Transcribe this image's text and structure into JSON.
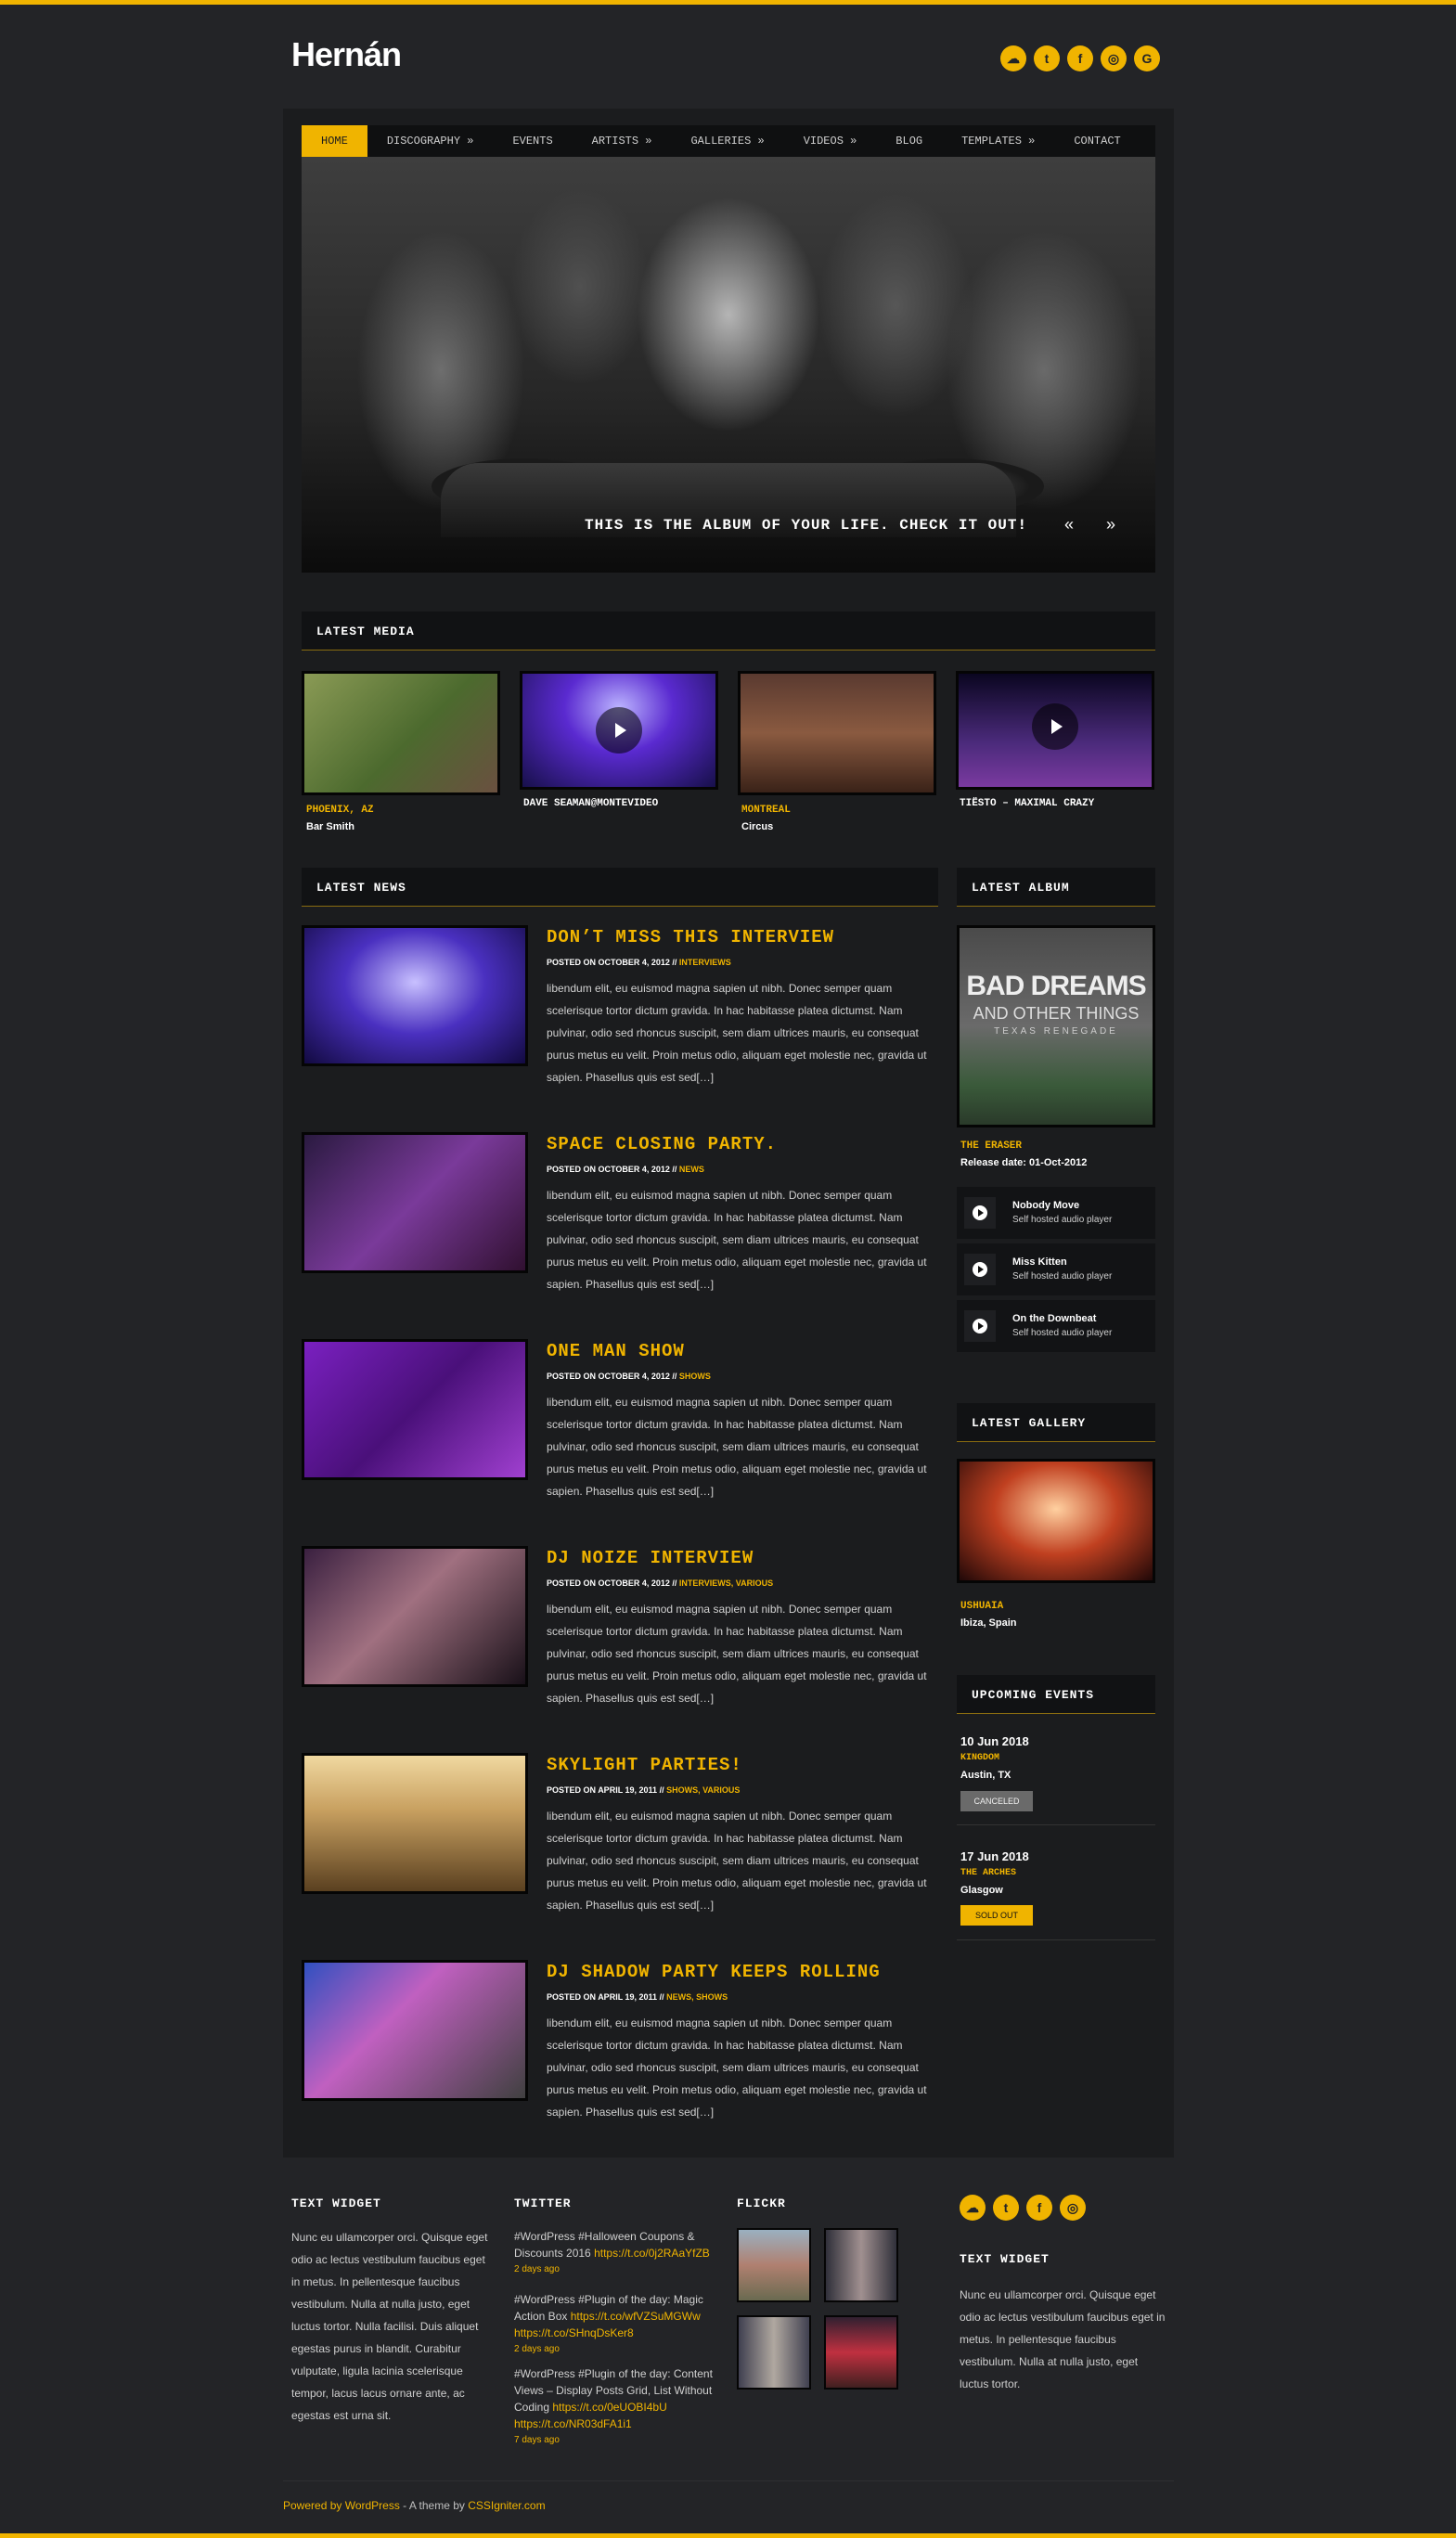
{
  "site": {
    "logo": "Hernán"
  },
  "header_social": [
    "soundcloud-icon",
    "twitter-icon",
    "facebook-icon",
    "instagram-icon",
    "google-icon"
  ],
  "nav": [
    {
      "label": "HOME",
      "active": true
    },
    {
      "label": "DISCOGRAPHY »"
    },
    {
      "label": "EVENTS"
    },
    {
      "label": "ARTISTS »"
    },
    {
      "label": "GALLERIES »"
    },
    {
      "label": "VIDEOS »"
    },
    {
      "label": "BLOG"
    },
    {
      "label": "TEMPLATES »"
    },
    {
      "label": "CONTACT"
    }
  ],
  "slider": {
    "caption": "THIS IS THE ALBUM OF YOUR LIFE. CHECK IT OUT!",
    "prev": "«",
    "next": "»"
  },
  "latest_media": {
    "title": "LATEST MEDIA",
    "items": [
      {
        "line1": "PHOENIX, AZ",
        "line2": "Bar Smith"
      },
      {
        "line1": "DAVE SEAMAN@MONTEVIDEO",
        "line2": ""
      },
      {
        "line1": "MONTREAL",
        "line2": "Circus"
      },
      {
        "line1": "TIËSTO – MAXIMAL CRAZY",
        "line2": ""
      }
    ]
  },
  "latest_news": {
    "title": "LATEST NEWS",
    "posted_prefix": "POSTED ON",
    "posts": [
      {
        "title": "DON’T MISS THIS INTERVIEW",
        "date": "OCTOBER 4, 2012",
        "cats": "INTERVIEWS"
      },
      {
        "title": "SPACE CLOSING PARTY.",
        "date": "OCTOBER 4, 2012",
        "cats": "NEWS"
      },
      {
        "title": "ONE MAN SHOW",
        "date": "OCTOBER 4, 2012",
        "cats": "SHOWS"
      },
      {
        "title": "DJ NOIZE INTERVIEW",
        "date": "OCTOBER 4, 2012",
        "cats": "INTERVIEWS, VARIOUS"
      },
      {
        "title": "SKYLIGHT PARTIES!",
        "date": "APRIL 19, 2011",
        "cats": "SHOWS, VARIOUS"
      },
      {
        "title": "DJ SHADOW PARTY KEEPS ROLLING",
        "date": "APRIL 19, 2011",
        "cats": "NEWS, SHOWS"
      }
    ],
    "excerpt": "libendum elit, eu euismod magna sapien ut nibh. Donec semper quam scelerisque tortor dictum gravida. In hac habitasse platea dictumst. Nam pulvinar, odio sed rhoncus suscipit, sem diam ultrices mauris, eu consequat purus metus eu velit. Proin metus odio, aliquam eget molestie nec, gravida ut sapien. Phasellus quis est sed[…]"
  },
  "latest_album": {
    "title": "LATEST ALBUM",
    "cover_line1": "BAD DREAMS",
    "cover_line2": "AND OTHER THINGS",
    "cover_line3": "TEXAS RENEGADE",
    "name": "THE ERASER",
    "release": "Release date: 01-Oct-2012",
    "tracks": [
      {
        "title": "Nobody Move",
        "sub": "Self hosted audio player"
      },
      {
        "title": "Miss Kitten",
        "sub": "Self hosted audio player"
      },
      {
        "title": "On the Downbeat",
        "sub": "Self hosted audio player"
      }
    ]
  },
  "latest_gallery": {
    "title": "LATEST GALLERY",
    "name": "USHUAIA",
    "place": "Ibiza, Spain"
  },
  "upcoming_events": {
    "title": "UPCOMING EVENTS",
    "items": [
      {
        "date": "10 Jun 2018",
        "venue": "KINGDOM",
        "city": "Austin, TX",
        "status": "CANCELED"
      },
      {
        "date": "17 Jun 2018",
        "venue": "THE ARCHES",
        "city": "Glasgow",
        "status": "SOLD OUT"
      }
    ]
  },
  "footer": {
    "text_widget_title": "TEXT WIDGET",
    "text_widget_body": "Nunc eu ullamcorper orci. Quisque eget odio ac lectus vestibulum faucibus eget in metus. In pellentesque faucibus vestibulum. Nulla at nulla justo, eget luctus tortor. Nulla facilisi. Duis aliquet egestas purus in blandit. Curabitur vulputate, ligula lacinia scelerisque tempor, lacus lacus ornare ante, ac egestas est urna sit.",
    "twitter_title": "TWITTER",
    "tweets": [
      {
        "text": "#WordPress #Halloween Coupons & Discounts 2016 ",
        "link": "https://t.co/0j2RAaYfZB",
        "ago": "2 days ago"
      },
      {
        "text": "#WordPress #Plugin of the day: Magic Action Box ",
        "link": "https://t.co/wfVZSuMGWw https://t.co/SHnqDsKer8",
        "ago": "2 days ago"
      },
      {
        "text": "#WordPress #Plugin of the day: Content Views – Display Posts Grid, List Without Coding ",
        "link": "https://t.co/0eUOBI4bU https://t.co/NR03dFA1i1",
        "ago": "7 days ago"
      }
    ],
    "flickr_title": "FLICKR",
    "text_widget2_title": "TEXT WIDGET",
    "text_widget2_body": "Nunc eu ullamcorper orci. Quisque eget odio ac lectus vestibulum faucibus eget in metus. In pellentesque faucibus vestibulum. Nulla at nulla justo, eget luctus tortor.",
    "social": [
      "soundcloud-icon",
      "twitter-icon",
      "facebook-icon",
      "instagram-icon"
    ]
  },
  "bottom": {
    "powered": "Powered by WordPress",
    "sep": " - A theme by ",
    "theme": "CSSIgniter.com"
  },
  "colors": {
    "accent": "#f0b400",
    "panel": "#1b1c1e",
    "bg": "#232427"
  }
}
